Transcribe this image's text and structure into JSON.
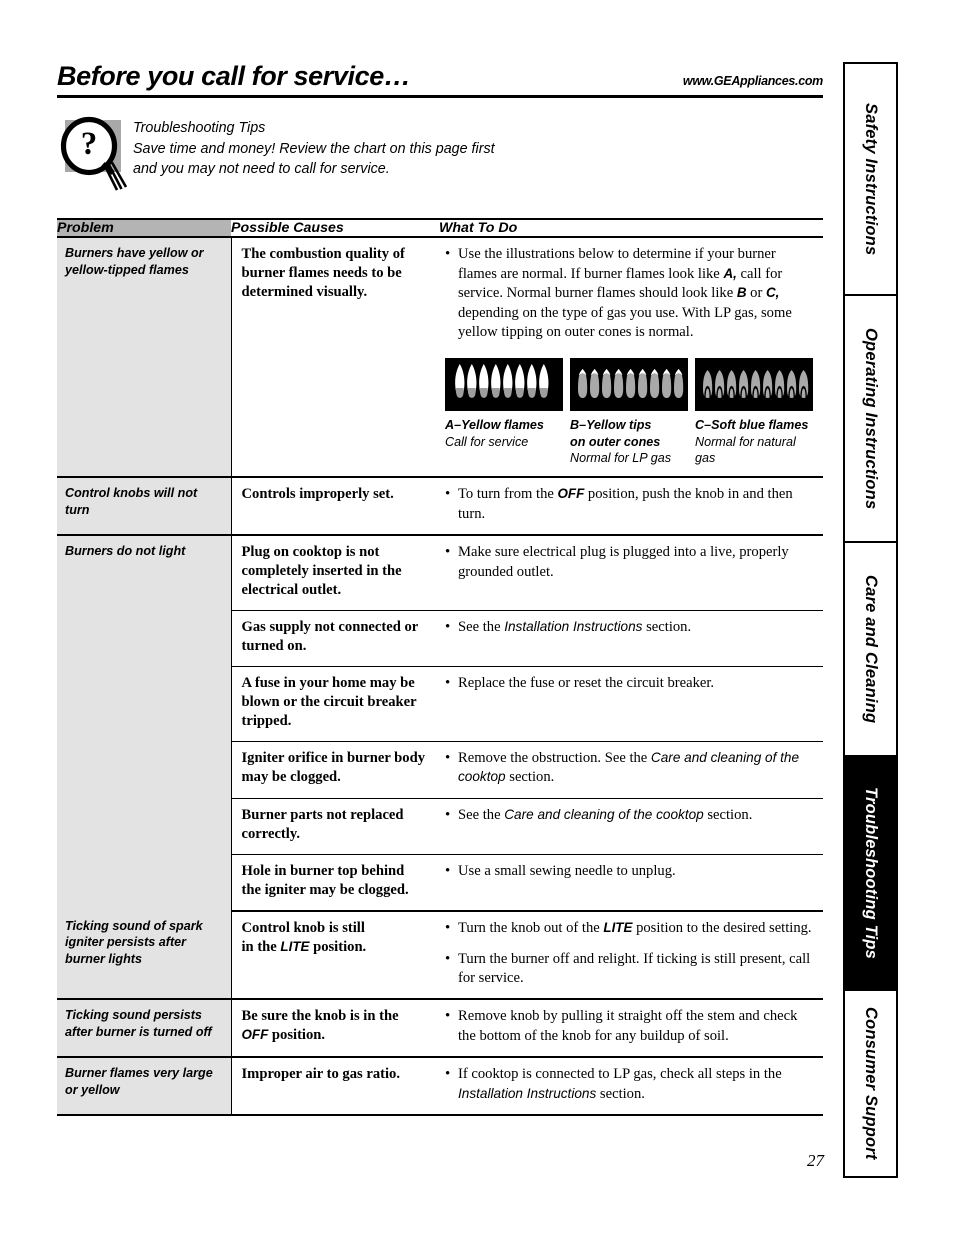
{
  "header": {
    "title": "Before you call for service…",
    "url": "www.GEAppliances.com"
  },
  "tip": {
    "icon": "magnifier-question-icon",
    "line1": "Troubleshooting Tips",
    "line2": "Save time and money! Review the chart on this page first",
    "line3": "and you may not need to call for service."
  },
  "table": {
    "headers": {
      "problem": "Problem",
      "causes": "Possible Causes",
      "whattodo": "What To Do"
    },
    "rows": [
      {
        "problem": "Burners have yellow or yellow-tipped flames",
        "cause": "The combustion quality of burner flames needs to be determined visually.",
        "todo": "Use the illustrations below to determine if your burner flames are normal. If burner flames look like A, call for service. Normal burner flames should look like B or C, depending on the type of gas you use. With LP gas, some yellow tipping on outer cones is normal."
      },
      {
        "problem": "Control knobs will not turn",
        "cause": "Controls improperly set.",
        "todo": "To turn from the OFF position, push the knob in and then turn."
      },
      {
        "problem": "Burners do not light",
        "cause": "Plug on cooktop is not completely inserted in the electrical outlet.",
        "todo": "Make sure electrical plug is plugged into a live, properly grounded outlet."
      },
      {
        "problem": "",
        "cause": "Gas supply not connected or turned on.",
        "todo": "See the Installation Instructions section."
      },
      {
        "problem": "",
        "cause": "A fuse in your home may be blown or the circuit breaker tripped.",
        "todo": "Replace the fuse or reset the circuit breaker."
      },
      {
        "problem": "",
        "cause": "Igniter orifice in burner body may be clogged.",
        "todo": "Remove the obstruction. See the Care and cleaning of the cooktop section."
      },
      {
        "problem": "",
        "cause": "Burner parts not replaced correctly.",
        "todo": "See the Care and cleaning of the cooktop section."
      },
      {
        "problem": "",
        "cause": "Hole in burner top behind the igniter may be clogged.",
        "todo": "Use a small sewing needle to unplug."
      },
      {
        "problem": "Ticking sound of spark igniter persists after burner lights",
        "cause": "Control knob is still in the LITE position.",
        "todo": "Turn the knob out of the LITE position to the desired setting.",
        "todo2": "Turn the burner off and relight. If ticking is still present, call for service."
      },
      {
        "problem": "Ticking sound persists after burner is turned off",
        "cause": "Be sure the knob is in the OFF position.",
        "todo": "Remove knob by pulling it straight off the stem and check the bottom of the knob for any buildup of soil."
      },
      {
        "problem": "Burner flames very large or yellow",
        "cause": "Improper air to gas ratio.",
        "todo": "If cooktop is connected to LP gas, check all steps in the Installation Instructions section."
      }
    ]
  },
  "flames": [
    {
      "id": "flame-a",
      "title": "A–Yellow flames",
      "line2": "Call for service",
      "line3": ""
    },
    {
      "id": "flame-b",
      "title": "B–Yellow tips",
      "line2": "on outer cones",
      "line3": "Normal for LP gas"
    },
    {
      "id": "flame-c",
      "title": "C–Soft blue flames",
      "line2": "Normal for natural",
      "line3": "gas"
    }
  ],
  "side_tabs": [
    {
      "label": "Safety Instructions",
      "active": false
    },
    {
      "label": "Operating Instructions",
      "active": false
    },
    {
      "label": "Care and Cleaning",
      "active": false
    },
    {
      "label": "Troubleshooting Tips",
      "active": true
    },
    {
      "label": "Consumer Support",
      "active": false
    }
  ],
  "page_number": "27",
  "colors": {
    "problem_header_bg": "#b4b4b4",
    "problem_cell_bg": "#e3e3e3",
    "flame_box_bg": "#000000",
    "flame_yellow": "#ffffff",
    "flame_blue": "#a9a9a9",
    "tip_icon_bg": "#a8a8a8"
  }
}
